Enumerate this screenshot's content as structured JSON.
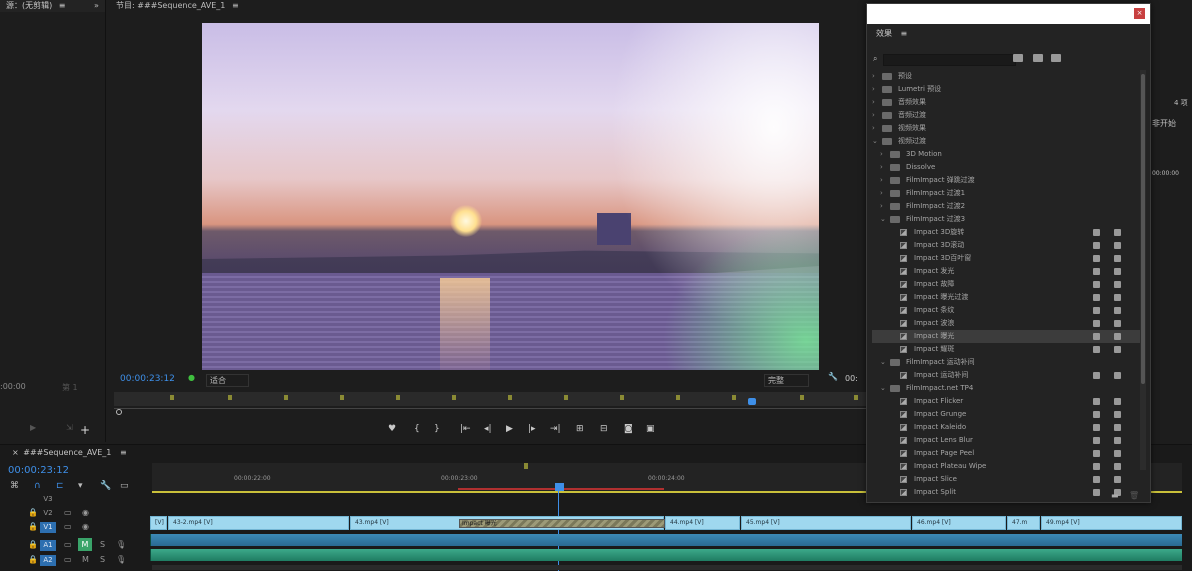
{
  "source": {
    "title": "源：(无剪辑)",
    "timecode": ":00:00",
    "frame_label": "第 1"
  },
  "program": {
    "title": "节目: ###Sequence_AVE_1",
    "timecode": "00:00:23:12",
    "fit_label": "适合",
    "quality_label": "完整",
    "right_timecode": "00:"
  },
  "timeline": {
    "title": "###Sequence_AVE_1",
    "timecode": "00:00:23:12",
    "ruler": [
      "00:00:22:00",
      "00:00:23:00",
      "00:00:24:00"
    ],
    "tracks": [
      "V3",
      "V2",
      "V1",
      "A1",
      "A2"
    ],
    "video_clips": [
      {
        "label": "[V]"
      },
      {
        "label": "43-2.mp4 [V]"
      },
      {
        "label": "43.mp4 [V]"
      },
      {
        "label": "Impact 曝光"
      },
      {
        "label": "44.mp4 [V]"
      },
      {
        "label": "45.mp4 [V]"
      },
      {
        "label": "46.mp4 [V]"
      },
      {
        "label": "47.m"
      },
      {
        "label": "49.mp4 [V]"
      }
    ]
  },
  "right_panel": {
    "count": "4 项",
    "header": "非开始",
    "time": "00:00:00"
  },
  "effects": {
    "tab": "效果",
    "menu_icon": "≡",
    "items": [
      {
        "label": "预设",
        "level": 0,
        "kind": "folder",
        "expanded": false
      },
      {
        "label": "Lumetri 预设",
        "level": 0,
        "kind": "folder",
        "expanded": false
      },
      {
        "label": "音频效果",
        "level": 0,
        "kind": "folder",
        "expanded": false
      },
      {
        "label": "音频过渡",
        "level": 0,
        "kind": "folder",
        "expanded": false
      },
      {
        "label": "视频效果",
        "level": 0,
        "kind": "folder",
        "expanded": false
      },
      {
        "label": "视频过渡",
        "level": 0,
        "kind": "folder",
        "expanded": true
      },
      {
        "label": "3D Motion",
        "level": 1,
        "kind": "folder",
        "expanded": false
      },
      {
        "label": "Dissolve",
        "level": 1,
        "kind": "folder",
        "expanded": false
      },
      {
        "label": "FilmImpact 弹跳过渡",
        "level": 1,
        "kind": "folder",
        "expanded": false
      },
      {
        "label": "FilmImpact 过渡1",
        "level": 1,
        "kind": "folder",
        "expanded": false
      },
      {
        "label": "FilmImpact 过渡2",
        "level": 1,
        "kind": "folder",
        "expanded": false
      },
      {
        "label": "FilmImpact 过渡3",
        "level": 1,
        "kind": "folder",
        "expanded": true
      },
      {
        "label": "Impact 3D旋转",
        "level": 2,
        "kind": "fx"
      },
      {
        "label": "Impact 3D滚动",
        "level": 2,
        "kind": "fx"
      },
      {
        "label": "Impact 3D百叶窗",
        "level": 2,
        "kind": "fx"
      },
      {
        "label": "Impact 发光",
        "level": 2,
        "kind": "fx"
      },
      {
        "label": "Impact 故障",
        "level": 2,
        "kind": "fx"
      },
      {
        "label": "Impact 曝光过渡",
        "level": 2,
        "kind": "fx"
      },
      {
        "label": "Impact 条纹",
        "level": 2,
        "kind": "fx"
      },
      {
        "label": "Impact 波浪",
        "level": 2,
        "kind": "fx"
      },
      {
        "label": "Impact 曝光",
        "level": 2,
        "kind": "fx",
        "selected": true
      },
      {
        "label": "Impact 耀斑",
        "level": 2,
        "kind": "fx"
      },
      {
        "label": "FilmImpact 运动补间",
        "level": 1,
        "kind": "folder",
        "expanded": true
      },
      {
        "label": "Impact 运动补间",
        "level": 2,
        "kind": "fx"
      },
      {
        "label": "FilmImpact.net TP4",
        "level": 1,
        "kind": "folder",
        "expanded": true
      },
      {
        "label": "Impact Flicker",
        "level": 2,
        "kind": "fx"
      },
      {
        "label": "Impact Grunge",
        "level": 2,
        "kind": "fx"
      },
      {
        "label": "Impact Kaleido",
        "level": 2,
        "kind": "fx"
      },
      {
        "label": "Impact Lens Blur",
        "level": 2,
        "kind": "fx"
      },
      {
        "label": "Impact Page Peel",
        "level": 2,
        "kind": "fx"
      },
      {
        "label": "Impact Plateau Wipe",
        "level": 2,
        "kind": "fx"
      },
      {
        "label": "Impact Slice",
        "level": 2,
        "kind": "fx"
      },
      {
        "label": "Impact Split",
        "level": 2,
        "kind": "fx"
      }
    ]
  }
}
